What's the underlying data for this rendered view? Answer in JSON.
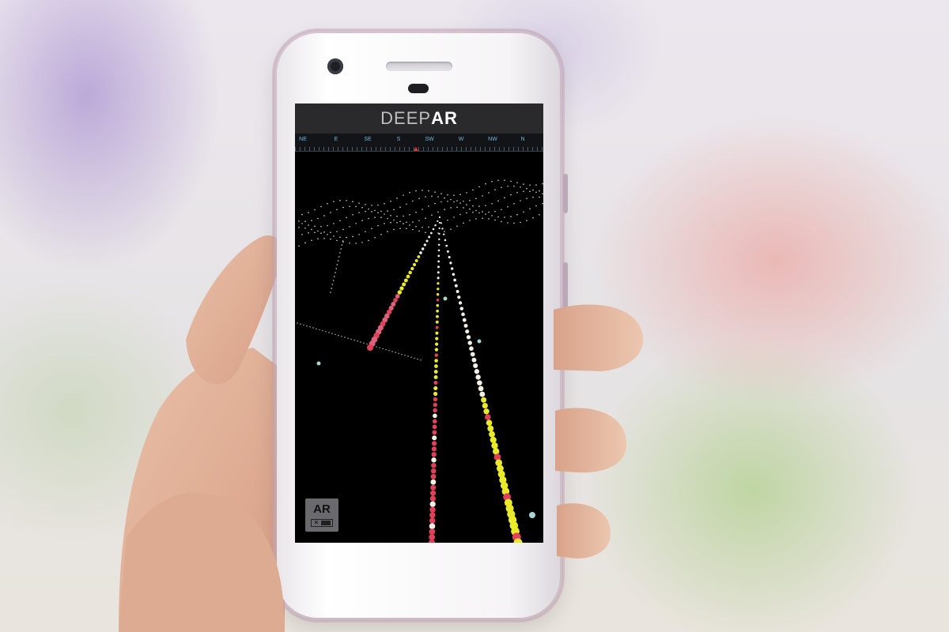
{
  "app": {
    "logo_text": "DEEP",
    "logo_accent": "AR"
  },
  "compass": {
    "labels": [
      "NE",
      "E",
      "SE",
      "S",
      "SW",
      "W",
      "NW",
      "N"
    ],
    "heading_color": "#e5362e",
    "label_color": "#6fb7d6"
  },
  "ar_toggle": {
    "label": "AR",
    "switch_off_glyph": "✕"
  },
  "colors": {
    "header_bg": "#2a2a2c",
    "marker_yellow": "#e8ea2a",
    "marker_red": "#e0405a",
    "marker_white": "#f2efe4"
  }
}
